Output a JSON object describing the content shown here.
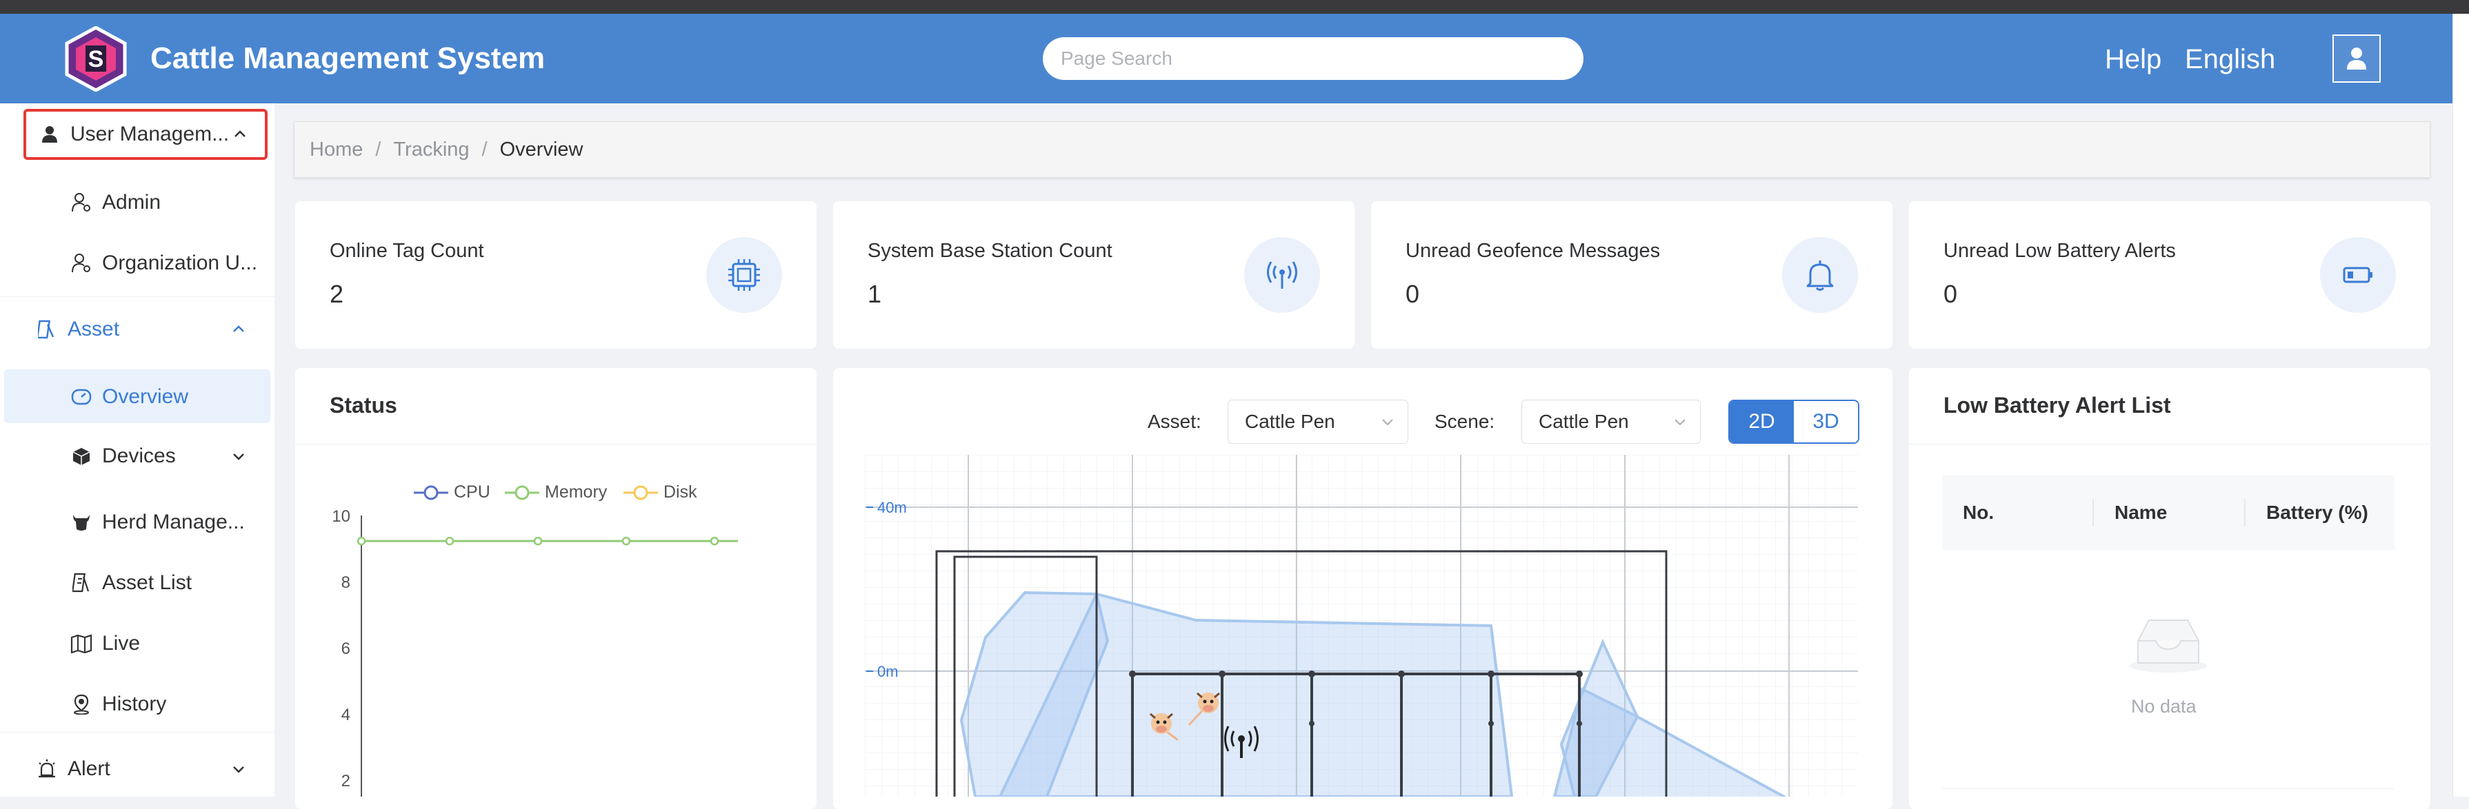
{
  "header": {
    "title": "Cattle Management System",
    "search_placeholder": "Page Search",
    "help": "Help",
    "language": "English"
  },
  "sidebar": {
    "items": [
      {
        "label": "User Managem...",
        "icon": "user-icon"
      },
      {
        "label": "Admin",
        "icon": "user-gear-icon"
      },
      {
        "label": "Organization U...",
        "icon": "user-gear-icon"
      },
      {
        "label": "Asset",
        "icon": "asset-icon"
      },
      {
        "label": "Overview",
        "icon": "dashboard-icon"
      },
      {
        "label": "Devices",
        "icon": "cube-icon"
      },
      {
        "label": "Herd Manage...",
        "icon": "cow-icon"
      },
      {
        "label": "Asset List",
        "icon": "list-icon"
      },
      {
        "label": "Live",
        "icon": "map-icon"
      },
      {
        "label": "History",
        "icon": "location-icon"
      },
      {
        "label": "Alert",
        "icon": "alarm-icon"
      }
    ]
  },
  "breadcrumb": [
    "Home",
    "Tracking",
    "Overview"
  ],
  "stats": [
    {
      "label": "Online Tag Count",
      "value": "2",
      "icon": "chip-icon"
    },
    {
      "label": "System Base Station Count",
      "value": "1",
      "icon": "antenna-icon"
    },
    {
      "label": "Unread Geofence Messages",
      "value": "0",
      "icon": "bell-icon"
    },
    {
      "label": "Unread Low Battery Alerts",
      "value": "0",
      "icon": "battery-icon"
    }
  ],
  "status_panel": {
    "title": "Status",
    "legend": [
      "CPU",
      "Memory",
      "Disk"
    ],
    "yticks": [
      "10",
      "8",
      "6",
      "4",
      "2"
    ]
  },
  "chart_data": {
    "type": "line",
    "title": "",
    "series": [
      {
        "name": "CPU",
        "values": []
      },
      {
        "name": "Memory",
        "values": [
          9.3,
          9.3,
          9.3,
          9.3,
          9.3
        ]
      },
      {
        "name": "Disk",
        "values": []
      }
    ],
    "ylim": [
      0,
      10
    ],
    "colors": {
      "CPU": "#5470c6",
      "Memory": "#91cc75",
      "Disk": "#fac858"
    }
  },
  "map_panel": {
    "asset_label": "Asset:",
    "asset_value": "Cattle Pen",
    "scene_label": "Scene:",
    "scene_value": "Cattle Pen",
    "mode_2d": "2D",
    "mode_3d": "3D",
    "axis_40m": "40m",
    "axis_0m": "0m"
  },
  "battery_panel": {
    "title": "Low Battery Alert List",
    "columns": [
      "No.",
      "Name",
      "Battery (%)"
    ],
    "empty_text": "No data"
  },
  "colors": {
    "header_bg": "#4a86d0",
    "accent": "#3a7bd5",
    "highlight_border": "#e53935"
  }
}
